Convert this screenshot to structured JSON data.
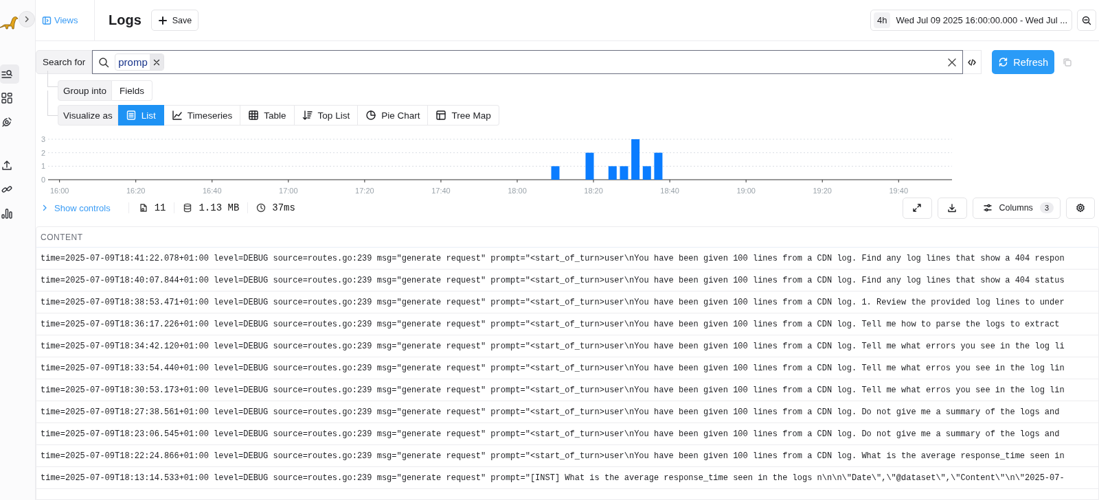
{
  "sidebar": {
    "items": [
      {
        "kind": "query",
        "selected": true
      },
      {
        "kind": "dashboards",
        "selected": false
      },
      {
        "kind": "monitors",
        "selected": false
      },
      {
        "kind": "upload",
        "selected": false
      },
      {
        "kind": "integrations",
        "selected": false
      },
      {
        "kind": "usage",
        "selected": false
      }
    ]
  },
  "header": {
    "views_link": "Views",
    "title": "Logs",
    "save_button": "Save",
    "time_range": {
      "preset": "4h",
      "label": "Wed Jul 09 2025 16:00:00.000 - Wed Jul ..."
    }
  },
  "search": {
    "label": "Search for",
    "tokens": [
      "promp"
    ],
    "refresh_button": "Refresh"
  },
  "group_into": {
    "label": "Group into",
    "value": "Fields"
  },
  "visualize": {
    "label": "Visualize as",
    "options": [
      {
        "label": "List",
        "kind": "list",
        "selected": true
      },
      {
        "label": "Timeseries",
        "kind": "timeseries",
        "selected": false
      },
      {
        "label": "Table",
        "kind": "table",
        "selected": false
      },
      {
        "label": "Top List",
        "kind": "toplist",
        "selected": false
      },
      {
        "label": "Pie Chart",
        "kind": "pie",
        "selected": false
      },
      {
        "label": "Tree Map",
        "kind": "treemap",
        "selected": false
      }
    ]
  },
  "chart": {
    "chart_data": {
      "type": "bar",
      "categories": [
        "16:00",
        null,
        null,
        null,
        null,
        null,
        null,
        null,
        null,
        null,
        null,
        null,
        null,
        null,
        null,
        null,
        null,
        null,
        null,
        null,
        "16:20",
        null,
        null,
        null,
        null,
        null,
        null,
        null,
        null,
        null,
        null,
        null,
        null,
        null,
        null,
        null,
        null,
        null,
        null,
        null,
        "16:40",
        null,
        null,
        null,
        null,
        null,
        null,
        null,
        null,
        null,
        null,
        null,
        null,
        null,
        null,
        null,
        null,
        null,
        null,
        null,
        "17:00",
        null,
        null,
        null,
        null,
        null,
        null,
        null,
        null,
        null,
        null,
        null,
        null,
        null,
        null,
        null,
        null,
        null,
        null,
        null,
        "17:20",
        null,
        null,
        null,
        null,
        null,
        null,
        null,
        null,
        null,
        null,
        null,
        null,
        null,
        null,
        null,
        null,
        null,
        null,
        null,
        "17:40",
        null,
        null,
        null,
        null,
        null,
        null,
        null,
        null,
        null,
        null,
        null,
        null,
        null,
        null,
        null,
        null,
        null,
        null,
        null,
        "18:00",
        null,
        null,
        null,
        null,
        null,
        null,
        null,
        null,
        null,
        null,
        null,
        null,
        null,
        null,
        null,
        null,
        null,
        null,
        null,
        "18:20",
        null,
        null,
        null,
        null,
        null,
        null,
        null,
        null,
        null,
        null,
        null,
        null,
        null,
        null,
        null,
        null,
        null,
        null,
        null,
        "18:40",
        null,
        null,
        null,
        null,
        null,
        null,
        null,
        null,
        null,
        null,
        null,
        null,
        null,
        null,
        null,
        null,
        null,
        null,
        null,
        "19:00",
        null,
        null,
        null,
        null,
        null,
        null,
        null,
        null,
        null,
        null,
        null,
        null,
        null,
        null,
        null,
        null,
        null,
        null,
        null,
        "19:20",
        null,
        null,
        null,
        null,
        null,
        null,
        null,
        null,
        null,
        null,
        null,
        null,
        null,
        null,
        null,
        null,
        null,
        null,
        null,
        "19:40",
        null,
        null,
        null,
        null,
        null,
        null,
        null,
        null,
        null,
        null,
        null,
        null,
        null,
        null
      ],
      "series": [
        {
          "color": "#0a7cff",
          "values": [
            0,
            0,
            0,
            0,
            0,
            0,
            0,
            0,
            0,
            0,
            0,
            0,
            0,
            0,
            0,
            0,
            0,
            0,
            0,
            0,
            0,
            0,
            0,
            0,
            0,
            0,
            0,
            0,
            0,
            0,
            0,
            0,
            0,
            0,
            0,
            0,
            0,
            0,
            0,
            0,
            0,
            0,
            0,
            0,
            0,
            0,
            0,
            0,
            0,
            0,
            0,
            0,
            0,
            0,
            0,
            0,
            0,
            0,
            0,
            0,
            0,
            0,
            0,
            0,
            0,
            0,
            0,
            0,
            0,
            0,
            0,
            0,
            0,
            0,
            0,
            0,
            0,
            0,
            0,
            0,
            0,
            0,
            0,
            0,
            0,
            0,
            0,
            0,
            0,
            0,
            0,
            0,
            0,
            0,
            0,
            0,
            0,
            0,
            0,
            0,
            0,
            0,
            0,
            0,
            0,
            0,
            0,
            0,
            0,
            0,
            0,
            0,
            0,
            0,
            0,
            0,
            0,
            0,
            0,
            0,
            0,
            0,
            0,
            0,
            0,
            0,
            0,
            0,
            0,
            0,
            1,
            0,
            0,
            0,
            0,
            0,
            0,
            0,
            0,
            2,
            0,
            0,
            0,
            0,
            0,
            1,
            0,
            0,
            1,
            0,
            0,
            3,
            0,
            0,
            1,
            0,
            0,
            2,
            0,
            0,
            0,
            0,
            0,
            0,
            0,
            0,
            0,
            0,
            0,
            0,
            0,
            0,
            0,
            0,
            0,
            0,
            0,
            0,
            0,
            0,
            0,
            0,
            0,
            0,
            0,
            0,
            0,
            0,
            0,
            0,
            0,
            0,
            0,
            0,
            0,
            0,
            0,
            0,
            0,
            0,
            0,
            0,
            0,
            0,
            0,
            0,
            0,
            0,
            0,
            0,
            0,
            0,
            0,
            0,
            0,
            0,
            0,
            0,
            0,
            0,
            0,
            0,
            0,
            0,
            0,
            0,
            0,
            0,
            0,
            0,
            0,
            0,
            0,
            0,
            0
          ]
        }
      ],
      "ylim": [
        0,
        3
      ],
      "yticks": [
        0,
        1,
        2,
        3
      ]
    }
  },
  "stats": {
    "show_controls": "Show controls",
    "count": "11",
    "size": "1.13 MB",
    "duration": "37ms",
    "columns_button": "Columns",
    "columns_count": "3"
  },
  "table": {
    "columns": [
      "CONTENT"
    ],
    "rows": [
      "time=2025-07-09T18:41:22.078+01:00 level=DEBUG source=routes.go:239 msg=\"generate request\" prompt=\"<start_of_turn>user\\nYou have been given 100 lines from a CDN log. Find any log lines that show a 404 respon",
      "time=2025-07-09T18:40:07.844+01:00 level=DEBUG source=routes.go:239 msg=\"generate request\" prompt=\"<start_of_turn>user\\nYou have been given 100 lines from a CDN log. Find any log lines that show a 404 status",
      "time=2025-07-09T18:38:53.471+01:00 level=DEBUG source=routes.go:239 msg=\"generate request\" prompt=\"<start_of_turn>user\\nYou have been given 100 lines from a CDN log. 1. Review the provided log lines to under",
      "time=2025-07-09T18:36:17.226+01:00 level=DEBUG source=routes.go:239 msg=\"generate request\" prompt=\"<start_of_turn>user\\nYou have been given 100 lines from a CDN log. Tell me how to parse the logs to extract",
      "time=2025-07-09T18:34:42.120+01:00 level=DEBUG source=routes.go:239 msg=\"generate request\" prompt=\"<start_of_turn>user\\nYou have been given 100 lines from a CDN log. Tell me what errors you see in the log li",
      "time=2025-07-09T18:33:54.440+01:00 level=DEBUG source=routes.go:239 msg=\"generate request\" prompt=\"<start_of_turn>user\\nYou have been given 100 lines from a CDN log. Tell me what erros you see in the log lin",
      "time=2025-07-09T18:30:53.173+01:00 level=DEBUG source=routes.go:239 msg=\"generate request\" prompt=\"<start_of_turn>user\\nYou have been given 100 lines from a CDN log. Tell me what erros you see in the log lin",
      "time=2025-07-09T18:27:38.561+01:00 level=DEBUG source=routes.go:239 msg=\"generate request\" prompt=\"<start_of_turn>user\\nYou have been given 100 lines from a CDN log. Do not give me a summary of the logs and",
      "time=2025-07-09T18:23:06.545+01:00 level=DEBUG source=routes.go:239 msg=\"generate request\" prompt=\"<start_of_turn>user\\nYou have been given 100 lines from a CDN log. Do not give me a summary of the logs and",
      "time=2025-07-09T18:22:24.866+01:00 level=DEBUG source=routes.go:239 msg=\"generate request\" prompt=\"<start_of_turn>user\\nYou have been given 100 lines from a CDN log. What is the average response_time seen in",
      "time=2025-07-09T18:13:14.533+01:00 level=DEBUG source=routes.go:239 msg=\"generate request\" prompt=\"[INST] What is the average response_time seen in the logs n\\n\\n\\\"Date\\\",\\\"@dataset\\\",\\\"Content\\\"\\n\\\"2025-07-"
    ]
  }
}
